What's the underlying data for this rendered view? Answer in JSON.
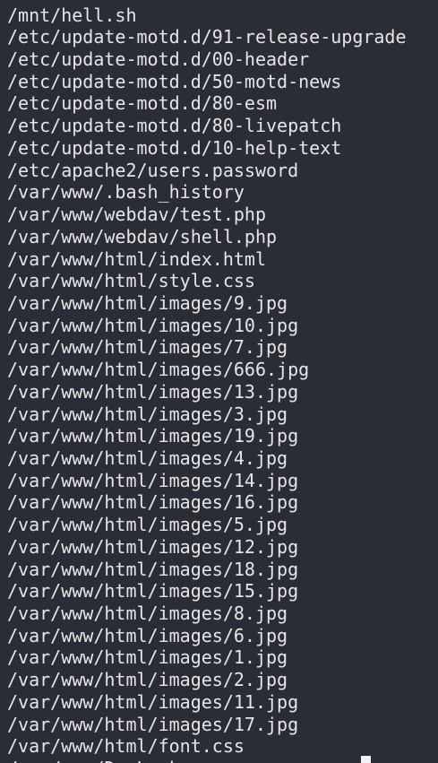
{
  "terminal": {
    "output_lines": [
      "/mnt/hell.sh",
      "/etc/update-motd.d/91-release-upgrade",
      "/etc/update-motd.d/00-header",
      "/etc/update-motd.d/50-motd-news",
      "/etc/update-motd.d/80-esm",
      "/etc/update-motd.d/80-livepatch",
      "/etc/update-motd.d/10-help-text",
      "/etc/apache2/users.password",
      "/var/www/.bash_history",
      "/var/www/webdav/test.php",
      "/var/www/webdav/shell.php",
      "/var/www/html/index.html",
      "/var/www/html/style.css",
      "/var/www/html/images/9.jpg",
      "/var/www/html/images/10.jpg",
      "/var/www/html/images/7.jpg",
      "/var/www/html/images/666.jpg",
      "/var/www/html/images/13.jpg",
      "/var/www/html/images/3.jpg",
      "/var/www/html/images/19.jpg",
      "/var/www/html/images/4.jpg",
      "/var/www/html/images/14.jpg",
      "/var/www/html/images/16.jpg",
      "/var/www/html/images/5.jpg",
      "/var/www/html/images/12.jpg",
      "/var/www/html/images/18.jpg",
      "/var/www/html/images/15.jpg",
      "/var/www/html/images/8.jpg",
      "/var/www/html/images/6.jpg",
      "/var/www/html/images/1.jpg",
      "/var/www/html/images/2.jpg",
      "/var/www/html/images/11.jpg",
      "/var/www/html/images/17.jpg",
      "/var/www/html/font.css",
      "/var/www/DavLock"
    ]
  },
  "colors": {
    "background": "#2a2d36",
    "text": "#e6e6e6",
    "cursor": "#f2f2f2"
  }
}
